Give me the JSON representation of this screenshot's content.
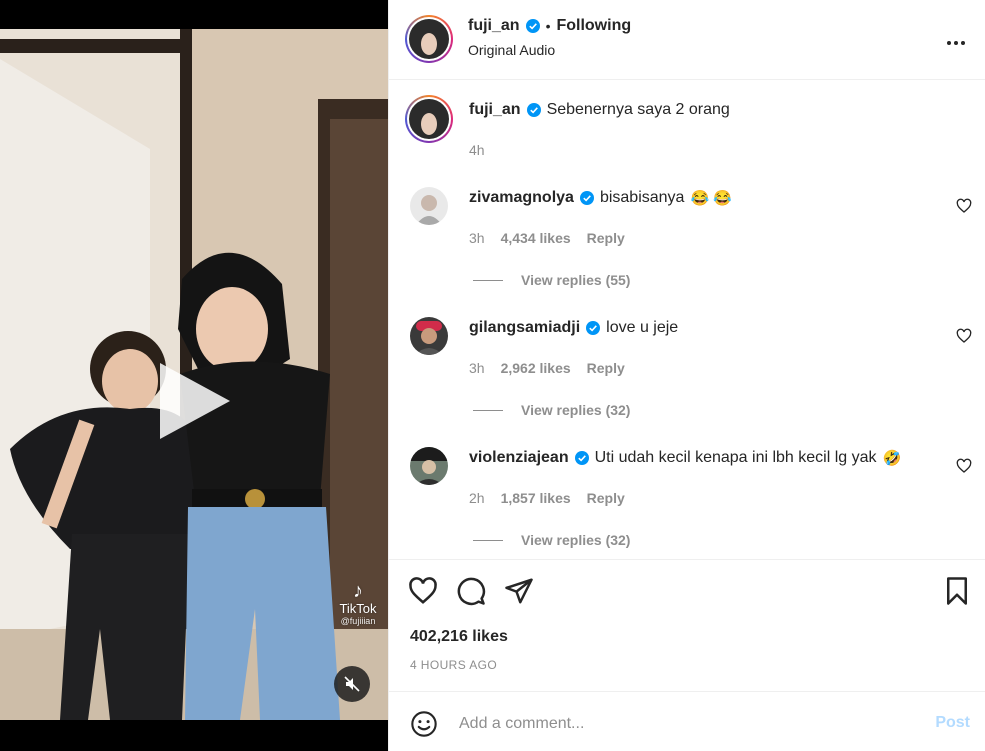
{
  "post": {
    "author": "fuji_an",
    "follow_sep": "•",
    "follow_status": "Following",
    "audio": "Original Audio",
    "more": "•••"
  },
  "media": {
    "watermark": "TikTok",
    "watermark_handle": "@fujiiian"
  },
  "caption": {
    "user": "fuji_an",
    "text": "Sebenernya saya 2 orang",
    "time": "4h"
  },
  "comments": [
    {
      "user": "zivamagnolya",
      "text": "bisabisanya",
      "emoji": "😂 😂",
      "time": "3h",
      "likes": "4,434 likes",
      "reply": "Reply",
      "view_replies": "View replies (55)"
    },
    {
      "user": "gilangsamiadji",
      "text": "love u jeje",
      "emoji": "",
      "time": "3h",
      "likes": "2,962 likes",
      "reply": "Reply",
      "view_replies": "View replies (32)"
    },
    {
      "user": "violenziajean",
      "text": "Uti udah kecil kenapa ini lbh kecil lg yak",
      "emoji": "🤣",
      "time": "2h",
      "likes": "1,857 likes",
      "reply": "Reply",
      "view_replies": "View replies (32)"
    }
  ],
  "stats": {
    "likes": "402,216 likes",
    "time_ago": "4 HOURS AGO"
  },
  "composer": {
    "placeholder": "Add a comment...",
    "post_label": "Post"
  },
  "icons": [
    "heart-icon",
    "comment-icon",
    "share-icon",
    "bookmark-icon",
    "emoji-icon",
    "mute-icon",
    "verified-icon",
    "play-icon",
    "more-icon"
  ],
  "colors": {
    "link_blue": "#0095f6",
    "post_disabled": "#b3dbff",
    "muted": "#8e8e8e",
    "verified": "#0095f6"
  }
}
